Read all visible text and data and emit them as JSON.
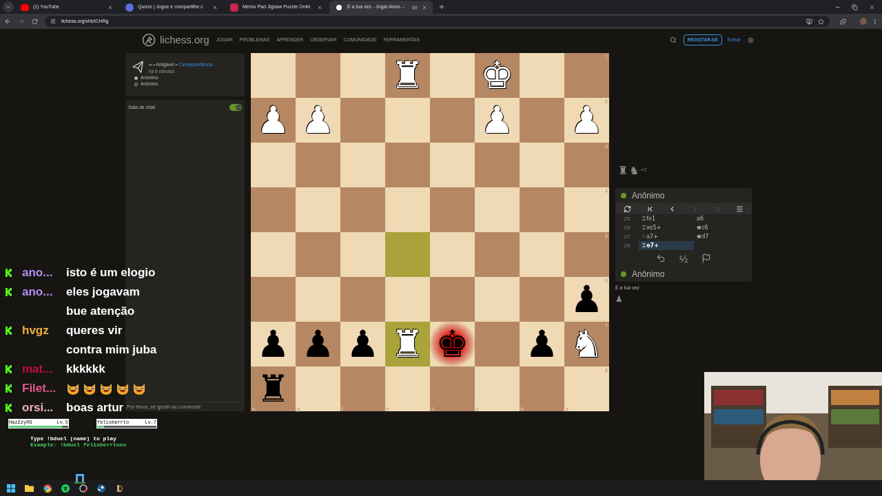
{
  "browser": {
    "tabs": [
      {
        "title": "(1) YouTube",
        "kind": "youtube",
        "selected": false
      },
      {
        "title": "Quizur | Jogue e compartilhe c",
        "kind": "quizur",
        "selected": false
      },
      {
        "title": "Memo Pad Jigsaw Puzzle Onlin",
        "kind": "jigsaw",
        "selected": false
      },
      {
        "title": "É a tua vez - Jogar Anon. -",
        "kind": "lichess",
        "selected": true
      }
    ],
    "url": "lichess.org/vHctCHRg"
  },
  "header": {
    "site": "lichess.org",
    "nav": [
      "JOGAR",
      "PROBLEMAS",
      "APRENDER",
      "OBSERVAR",
      "COMUNIDADE",
      "FERRAMENTAS"
    ],
    "register": "REGISTAR-SE",
    "login": "Entrar"
  },
  "game_info": {
    "mode": "∞ • Amigável •",
    "type": "Correspondência",
    "time": "há 6 minutos",
    "players": [
      {
        "name": "Anônimo",
        "white": true
      },
      {
        "name": "Anônimo",
        "white": false
      }
    ]
  },
  "chat": {
    "title": "Sala de chat",
    "on": true,
    "placeholder": "Por favor, sê gentil na conversa!"
  },
  "board": {
    "rows": [
      [
        null,
        null,
        null,
        {
          "piece": "♜",
          "white": true,
          "highlight": false,
          "check": false
        },
        null,
        {
          "piece": "♚",
          "white": true,
          "highlight": false,
          "check": false
        },
        null,
        null
      ],
      [
        {
          "piece": "♟",
          "white": true,
          "highlight": false,
          "check": false
        },
        {
          "piece": "♟",
          "white": true,
          "highlight": false,
          "check": false
        },
        null,
        null,
        null,
        {
          "piece": "♟",
          "white": true,
          "highlight": false,
          "check": false
        },
        null,
        {
          "piece": "♟",
          "white": true,
          "highlight": false,
          "check": false
        }
      ],
      [
        null,
        null,
        null,
        null,
        null,
        null,
        null,
        null
      ],
      [
        null,
        null,
        null,
        null,
        null,
        null,
        null,
        null
      ],
      [
        null,
        null,
        null,
        {
          "highlight": true,
          "check": false
        },
        null,
        null,
        null,
        null
      ],
      [
        null,
        null,
        null,
        null,
        null,
        null,
        null,
        {
          "piece": "♟",
          "white": false,
          "highlight": false,
          "check": false
        }
      ],
      [
        {
          "piece": "♟",
          "white": false,
          "highlight": false,
          "check": false
        },
        {
          "piece": "♟",
          "white": false,
          "highlight": false,
          "check": false
        },
        {
          "piece": "♟",
          "white": false,
          "highlight": false,
          "check": false
        },
        {
          "piece": "♜",
          "white": true,
          "highlight": true,
          "check": false
        },
        {
          "piece": "♚",
          "white": false,
          "highlight": false,
          "check": true
        },
        null,
        {
          "piece": "♟",
          "white": false,
          "highlight": false,
          "check": false
        },
        {
          "piece": "♞",
          "white": true,
          "highlight": false,
          "check": false
        }
      ],
      [
        {
          "piece": "♜",
          "white": false,
          "highlight": false,
          "check": false
        },
        null,
        null,
        null,
        null,
        null,
        null,
        null
      ]
    ],
    "rank_labels": [
      "1",
      "2",
      "3",
      "4",
      "5",
      "6",
      "7",
      "8"
    ],
    "file_labels": [
      "h",
      "g",
      "f",
      "e",
      "d",
      "c",
      "b",
      "a"
    ]
  },
  "side_panel": {
    "captured": {
      "pieces": [
        "♜",
        "♞"
      ],
      "score": "+7"
    },
    "top_player": {
      "name": "Anônimo",
      "online": true
    },
    "controls": [
      {
        "kind": "flip",
        "disabled": false
      },
      {
        "kind": "first",
        "disabled": false
      },
      {
        "kind": "prev",
        "disabled": false
      },
      {
        "kind": "next",
        "disabled": true
      },
      {
        "kind": "last",
        "disabled": true
      },
      {
        "kind": "menu",
        "disabled": false
      }
    ],
    "moves": [
      {
        "number": "25",
        "white": "♖fe1",
        "black": "a6",
        "selected": false
      },
      {
        "number": "26",
        "white": "♖xe5+",
        "black": "♚c6",
        "selected": false
      },
      {
        "number": "27",
        "white": "♘a7+",
        "black": "♚d7",
        "selected": false
      },
      {
        "number": "28",
        "white": "♖e7+",
        "selected": true
      }
    ],
    "actions": [
      {
        "kind": "takeback"
      },
      {
        "kind": "draw",
        "label": "½"
      },
      {
        "kind": "resign"
      }
    ],
    "bottom_player": {
      "name": "Anônimo",
      "online": true
    },
    "status": "É a tua vez",
    "piece_hint": "♟"
  },
  "stream_chat": [
    {
      "user": "ano...",
      "color": "#b48cf0",
      "kind": "text",
      "lines": [
        "isto é um elogio"
      ]
    },
    {
      "user": "ano...",
      "color": "#b48cf0",
      "kind": "text",
      "lines": [
        "eles jogavam",
        "bue atenção"
      ]
    },
    {
      "user": "hvgz",
      "color": "#f0b040",
      "kind": "text",
      "lines": [
        "queres vir",
        "contra mim juba"
      ]
    },
    {
      "user": "mat...",
      "color": "#c0103a",
      "kind": "text",
      "lines": [
        "kkkkkk"
      ]
    },
    {
      "user": "Filet...",
      "color": "#e05a8a",
      "kind": "emotes",
      "emotes": [
        {
          "kind": "cat"
        },
        {
          "kind": "cat"
        },
        {
          "kind": "cat"
        },
        {
          "kind": "cat"
        },
        {
          "kind": "cat"
        }
      ]
    },
    {
      "user": "orsi...",
      "color": "#f0b0c8",
      "kind": "text",
      "lines": [
        "boas artur"
      ]
    }
  ],
  "duel": {
    "fighters": [
      {
        "name": "HazZzyOG",
        "lv": "Lv.5",
        "level": 0.9
      },
      {
        "name": "felisberrto",
        "lv": "Lv.7",
        "level": 0.12
      }
    ],
    "hint": "Type !bduel (name) to play",
    "example": "Example: !bduel felisberrtooo"
  }
}
